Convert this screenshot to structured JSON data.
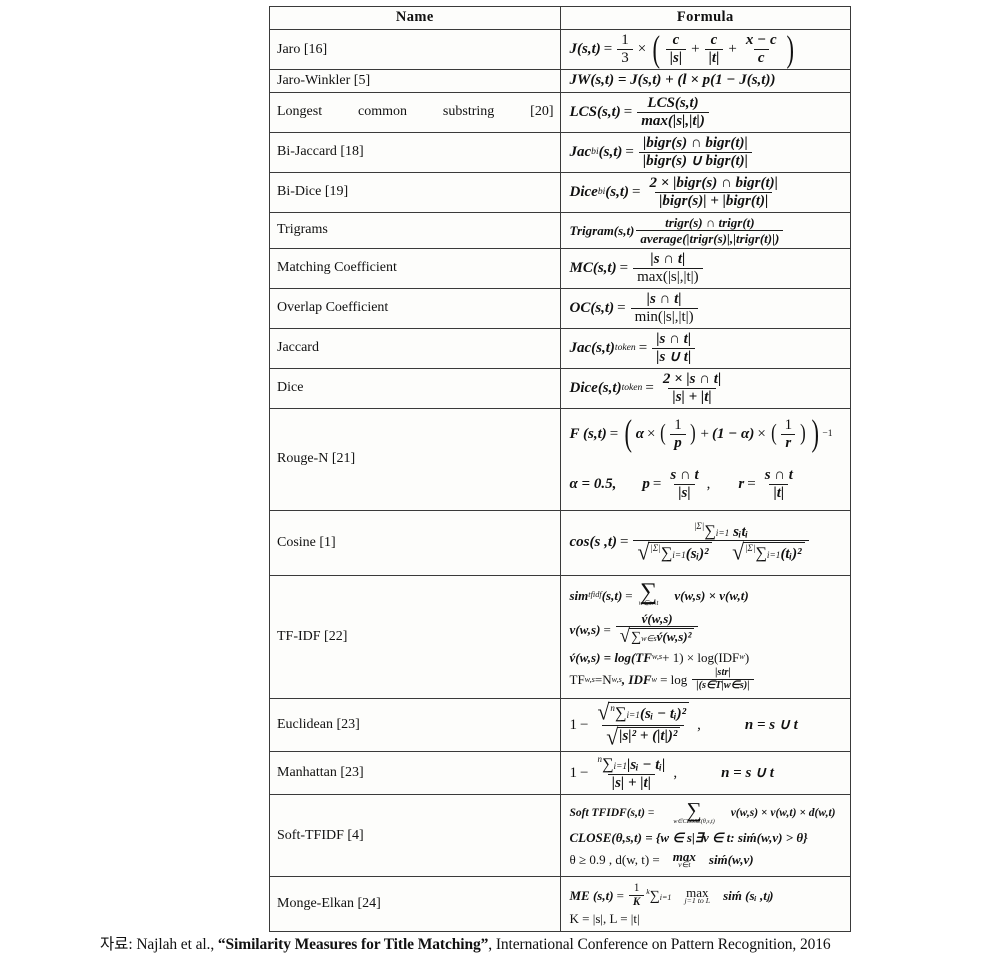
{
  "table": {
    "headers": {
      "name": "Name",
      "formula": "Formula"
    },
    "rows": [
      {
        "name": "Jaro [16]"
      },
      {
        "name": "Jaro-Winkler [5]"
      },
      {
        "name": "Longest common substring [20]"
      },
      {
        "name": "Bi-Jaccard [18]"
      },
      {
        "name": "Bi-Dice [19]"
      },
      {
        "name": "Trigrams"
      },
      {
        "name": "Matching Coefficient"
      },
      {
        "name": "Overlap Coefficient"
      },
      {
        "name": "Jaccard"
      },
      {
        "name": "Dice"
      },
      {
        "name": "Rouge-N [21]"
      },
      {
        "name": "Cosine [1]"
      },
      {
        "name": "TF-IDF [22]"
      },
      {
        "name": "Euclidean [23]"
      },
      {
        "name": "Manhattan [23]"
      },
      {
        "name": "Soft-TFIDF [4]"
      },
      {
        "name": "Monge-Elkan [24]"
      }
    ]
  },
  "formulas": {
    "jaro": {
      "lhs": "J(s,t)",
      "eq": "=",
      "third_num": "1",
      "third_den": "3",
      "times": "×",
      "t1_num": "c",
      "t1_den": "|s|",
      "plus1": "+",
      "t2_num": "c",
      "t2_den": "|t|",
      "plus2": "+",
      "t3_num": "x − c",
      "t3_den": "c"
    },
    "jaro_winkler": {
      "text": "JW(s,t) = J(s,t) + (l × p(1 − J(s,t))"
    },
    "lcs": {
      "lhs": "LCS(s,t)",
      "eq": "=",
      "num": "LCS(s,t)",
      "den": "max(|s|,|t|)"
    },
    "bi_jaccard": {
      "lhs": "Jac",
      "sub": "bi",
      "args": "(s,t)",
      "eq": "=",
      "num": "|bigr(s) ∩ bigr(t)|",
      "den": "|bigr(s) ∪ bigr(t)|"
    },
    "bi_dice": {
      "lhs": "Dice",
      "sub": "bi",
      "args": "(s,t)",
      "eq": "=",
      "num": "2 × |bigr(s) ∩ bigr(t)|",
      "den": "|bigr(s)| + |bigr(t)|"
    },
    "trigrams": {
      "lhs": "Trigram(s,t)",
      "num": "trigr(s) ∩ trigr(t)",
      "den": "average(|trigr(s)|,|trigr(t)|)"
    },
    "matching": {
      "lhs": "MC(s,t)",
      "eq": "=",
      "num": "|s ∩ t|",
      "den": "max(|s|,|t|)"
    },
    "overlap": {
      "lhs": "OC(s,t)",
      "eq": "=",
      "num": "|s ∩ t|",
      "den": "min(|s|,|t|)"
    },
    "jaccard": {
      "lhs": "Jac(s,t)",
      "sub": "token",
      "eq": "=",
      "num": "|s ∩ t|",
      "den": "|s ∪ t|"
    },
    "dice": {
      "lhs": "Dice(s,t)",
      "sub": "token",
      "eq": "=",
      "num": "2 × |s ∩ t|",
      "den": "|s| + |t|"
    },
    "rouge": {
      "line1_lhs": "F (s,t)",
      "eq": "=",
      "alpha": "α",
      "times": "×",
      "inv_p_num": "1",
      "inv_p_den": "p",
      "plus": "+",
      "one_minus": "(1 − α)",
      "inv_r_num": "1",
      "inv_r_den": "r",
      "exp": "−1",
      "line2_alpha": "α = 0.5,",
      "p_lhs": "p",
      "p_num": "s ∩ t",
      "p_den": "|s|",
      "comma": ",",
      "r_lhs": "r",
      "r_num": "s ∩ t",
      "r_den": "|t|"
    },
    "cosine": {
      "lhs": "cos(s ,t)",
      "eq": "=",
      "num": "∑",
      "num_lo": "i=1",
      "num_hi": "|Σ|",
      "num_tail": "sᵢtᵢ",
      "den_a": "∑",
      "den_a_lo": "i=1",
      "den_a_hi": "|Σ|",
      "den_a_tail": "(sᵢ)²",
      "den_b": "∑",
      "den_b_lo": "i=1",
      "den_b_hi": "|Σ|",
      "den_b_tail": "(tᵢ)²"
    },
    "tfidf": {
      "l1_lhs": "sim",
      "l1_sub": "tfidf",
      "l1_args": "(s,t)",
      "l1_eq": "=",
      "l1_sum": "∑",
      "l1_sum_lim": "w∈s∩t",
      "l1_tail": "v(w,s) × v(w,t)",
      "l2_lhs": "v(w,s)",
      "l2_eq": "=",
      "l2_num": "v́(w,s)",
      "l2_den_sum": "∑",
      "l2_den_sub": "w∈s",
      "l2_den_tail": "v́(w,s)²",
      "l3": "v́(w,s) = log(TF",
      "l3_sub": "w,s",
      "l3_b": " + 1) × log(IDF",
      "l3_sub2": "w",
      "l3_c": ")",
      "l4_a": "TF",
      "l4_a_sub": "w,s",
      "l4_b": "=N",
      "l4_b_sub": "w,s",
      "l4_c": ", IDF",
      "l4_c_sub": "w",
      "l4_eq": "= log",
      "l4_num": "|str|",
      "l4_den": "|(s∈T|w∈s)|"
    },
    "euclidean": {
      "one": "1",
      "minus": "−",
      "num_sum": "∑",
      "num_lo": "i=1",
      "num_hi": "n",
      "num_tail": "(sᵢ − tᵢ)²",
      "den": "|s|² + (|t|)²",
      "comma": ",",
      "cond": "n = s ∪ t"
    },
    "manhattan": {
      "one": "1",
      "minus": "−",
      "num_sum": "∑",
      "num_lo": "i=1",
      "num_hi": "n",
      "num_tail": "|sᵢ − tᵢ|",
      "den": "|s| + |t|",
      "comma": ",",
      "cond": "n = s ∪ t"
    },
    "soft_tfidf": {
      "l1_lhs": "Soft TFIDF(s,t)",
      "l1_eq": "=",
      "l1_sum": "∑",
      "l1_sum_lim": "w∈CLOSE(θ,s,t)",
      "l1_tail": "v(w,s) × v(w,t) × d(w,t)",
      "l2": "CLOSE(θ,s,t) = {w ∈ s|∃v ∈ t: siḿ(w,v) > θ}",
      "l3_a": "θ ≥ 0.9 , d(w, t) =",
      "l3_max": "max",
      "l3_max_sub": "v∈t",
      "l3_b": "siḿ(w,v)"
    },
    "monge_elkan": {
      "l1_lhs": "ME (s,t)",
      "l1_eq": "=",
      "l1_frac_num": "1",
      "l1_frac_den": "K",
      "l1_sum": "∑",
      "l1_sum_lo": "i=1",
      "l1_sum_hi": "k",
      "l1_max": "max",
      "l1_max_sub": "j=1 to L",
      "l1_tail": "siḿ (sᵢ ,tⱼ)",
      "l2": "K = |s|, L = |t|"
    }
  },
  "caption": {
    "prefix": "자료:",
    "authors": "Najlah et al.,",
    "title": "“Similarity Measures for Title Matching”",
    "rest": ", International Conference on Pattern Recognition, 2016"
  }
}
